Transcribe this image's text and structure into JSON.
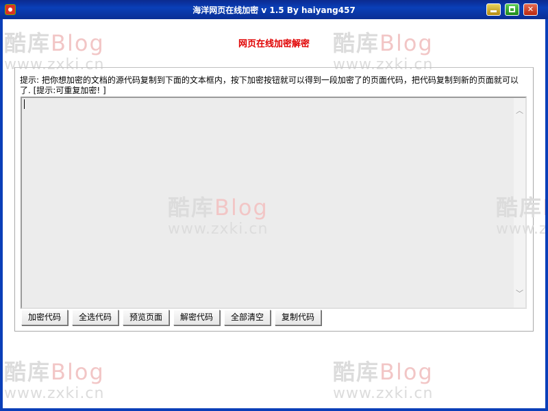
{
  "window": {
    "title": "海洋网页在线加密 v 1.5  By haiyang457"
  },
  "main": {
    "heading": "网页在线加密解密",
    "hint": "提示: 把你想加密的文档的源代码复制到下面的文本框内，按下加密按钮就可以得到一段加密了的页面代码，把代码复制到新的页面就可以了. [提示:可重复加密! ]",
    "textarea_value": ""
  },
  "buttons": {
    "encrypt": "加密代码",
    "select_all": "全选代码",
    "preview": "预览页面",
    "decrypt": "解密代码",
    "clear_all": "全部清空",
    "copy": "复制代码"
  },
  "watermark": {
    "line1_cn": "酷库",
    "line1_blog": "Blog",
    "line2": "www.zxki.cn"
  },
  "icons": {
    "app": "app-icon",
    "minimize": "minimize-icon",
    "maximize": "maximize-icon",
    "close": "close-icon",
    "scroll_up": "chevron-up-icon",
    "scroll_down": "chevron-down-icon"
  }
}
